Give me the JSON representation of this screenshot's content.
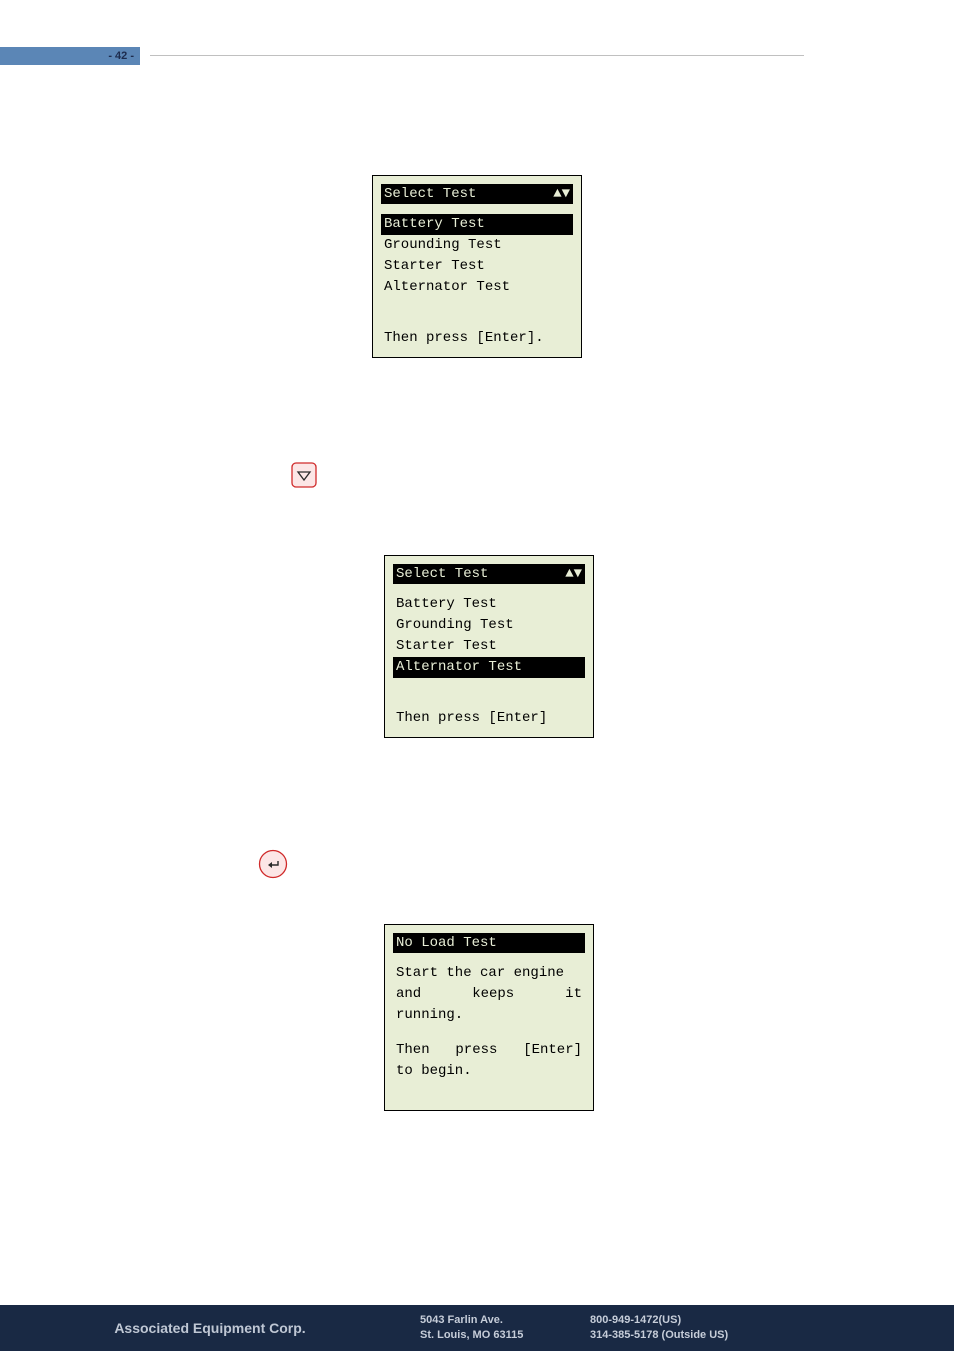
{
  "page_number_label": "- 42 -",
  "lcd1": {
    "title": "Select Test",
    "arrows": "▲▼",
    "items": [
      "Battery Test",
      "Grounding Test",
      "Starter Test",
      "Alternator Test"
    ],
    "selected_index": 0,
    "footer": "Then press [Enter]."
  },
  "lcd2": {
    "title": "Select Test",
    "arrows": "▲▼",
    "items": [
      "Battery Test",
      "Grounding Test",
      "Starter Test",
      "Alternator Test"
    ],
    "selected_index": 3,
    "footer": "Then press [Enter]"
  },
  "lcd3": {
    "title": "No Load Test",
    "body_line1": "Start the car engine",
    "body_line2a": "and",
    "body_line2b": "keeps",
    "body_line2c": "it",
    "body_line3": "running.",
    "body_line4a": "Then",
    "body_line4b": "press",
    "body_line4c": "[Enter]",
    "body_line5": "to begin."
  },
  "footer": {
    "company": "Associated Equipment Corp.",
    "addr1": "5043 Farlin Ave.",
    "addr2": "St. Louis, MO 63115",
    "phone1": "800-949-1472(US)",
    "phone2": "314-385-5178 (Outside US)"
  }
}
